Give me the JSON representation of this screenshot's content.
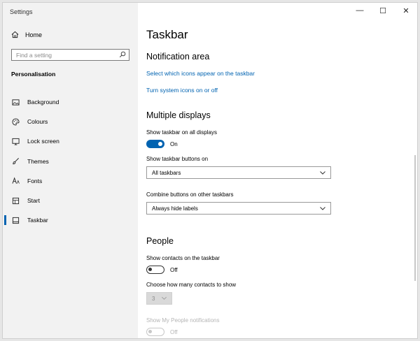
{
  "window": {
    "title": "Settings",
    "controls": [
      "—",
      "☐",
      "✕"
    ]
  },
  "sidebar": {
    "home_label": "Home",
    "search_placeholder": "Find a setting",
    "section_title": "Personalisation",
    "items": [
      {
        "label": "Background",
        "icon": "picture-icon",
        "selected": false
      },
      {
        "label": "Colours",
        "icon": "palette-icon",
        "selected": false
      },
      {
        "label": "Lock screen",
        "icon": "lock-screen-icon",
        "selected": false
      },
      {
        "label": "Themes",
        "icon": "brush-icon",
        "selected": false
      },
      {
        "label": "Fonts",
        "icon": "font-icon",
        "selected": false
      },
      {
        "label": "Start",
        "icon": "start-icon",
        "selected": false
      },
      {
        "label": "Taskbar",
        "icon": "taskbar-icon",
        "selected": true
      }
    ]
  },
  "main": {
    "page_title": "Taskbar",
    "notification_area": {
      "heading": "Notification area",
      "link1": "Select which icons appear on the taskbar",
      "link2": "Turn system icons on or off"
    },
    "multiple_displays": {
      "heading": "Multiple displays",
      "show_all_label": "Show taskbar on all displays",
      "show_all_state": "On",
      "buttons_on_label": "Show taskbar buttons on",
      "buttons_on_value": "All taskbars",
      "combine_label": "Combine buttons on other taskbars",
      "combine_value": "Always hide labels"
    },
    "people": {
      "heading": "People",
      "contacts_label": "Show contacts on the taskbar",
      "contacts_state": "Off",
      "count_label": "Choose how many contacts to show",
      "count_value": "3",
      "notifications_label": "Show My People notifications",
      "notifications_state": "Off"
    }
  },
  "colors": {
    "accent": "#0063b1",
    "sidebar_bg": "#f2f2f2",
    "disabled": "#b5b5b5"
  }
}
